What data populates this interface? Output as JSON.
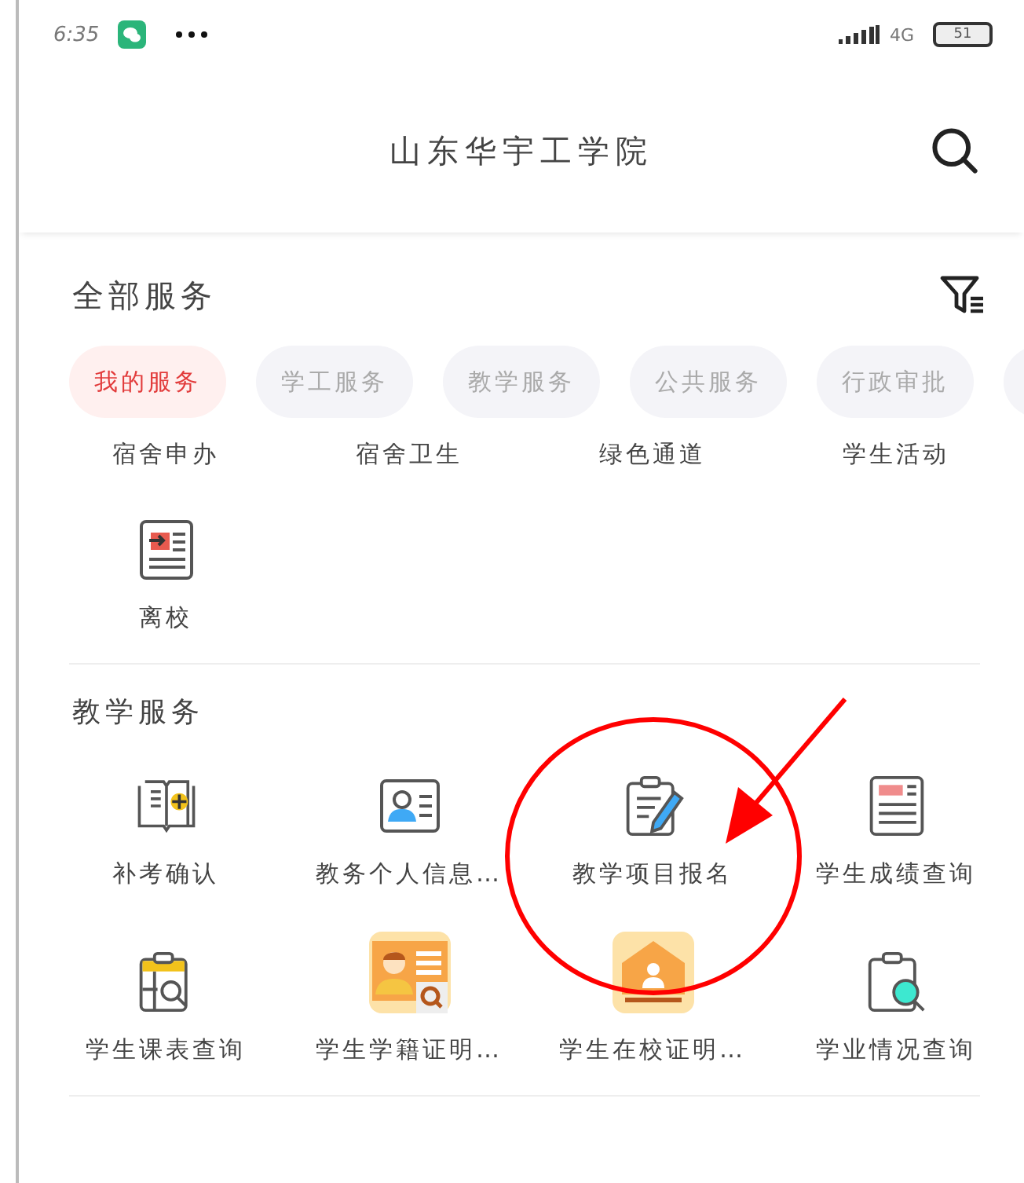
{
  "status_bar": {
    "time": "6:35",
    "network": "4G",
    "battery": "51"
  },
  "header": {
    "title": "山东华宇工学院"
  },
  "all_services": {
    "title": "全部服务",
    "tabs": [
      {
        "label": "我的服务",
        "selected": true
      },
      {
        "label": "学工服务",
        "selected": false
      },
      {
        "label": "教学服务",
        "selected": false
      },
      {
        "label": "公共服务",
        "selected": false
      },
      {
        "label": "行政审批",
        "selected": false
      }
    ],
    "items": [
      {
        "label": "宿舍申办",
        "kind": "text"
      },
      {
        "label": "宿舍卫生",
        "kind": "text"
      },
      {
        "label": "绿色通道",
        "kind": "text"
      },
      {
        "label": "学生活动",
        "kind": "text"
      },
      {
        "label": "离校",
        "kind": "icon"
      }
    ]
  },
  "teaching_services": {
    "title": "教学服务",
    "items": [
      {
        "label": "补考确认",
        "kind": "icon"
      },
      {
        "label": "教务个人信息…",
        "kind": "icon"
      },
      {
        "label": "教学项目报名",
        "kind": "icon"
      },
      {
        "label": "学生成绩查询",
        "kind": "icon"
      },
      {
        "label": "学生课表查询",
        "kind": "icon"
      },
      {
        "label": "学生学籍证明…",
        "kind": "icon"
      },
      {
        "label": "学生在校证明…",
        "kind": "icon"
      },
      {
        "label": "学业情况查询",
        "kind": "icon"
      }
    ]
  }
}
